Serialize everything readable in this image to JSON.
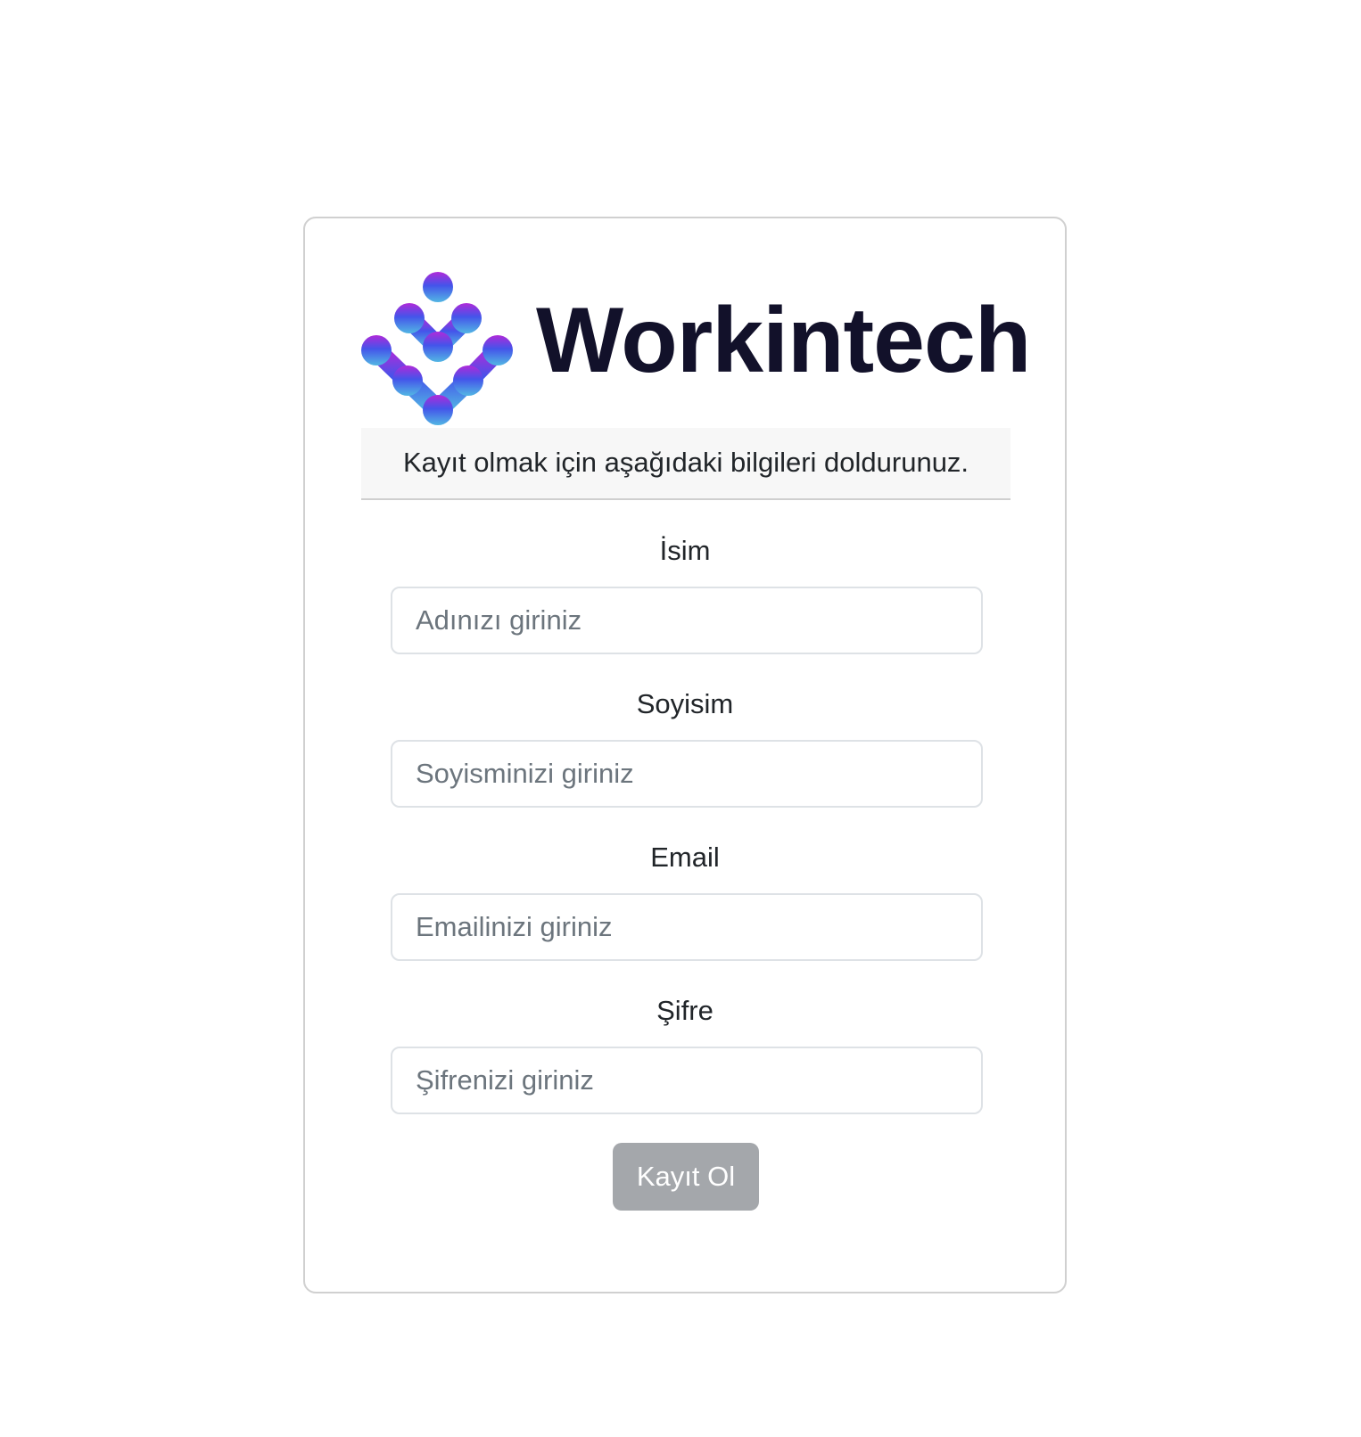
{
  "brand": {
    "name": "Workintech",
    "gradient_top": "#b02ad9",
    "gradient_mid": "#4454ea",
    "gradient_bottom": "#52b6e4"
  },
  "form": {
    "description": "Kayıt olmak için aşağıdaki bilgileri doldurunuz.",
    "fields": [
      {
        "label": "İsim",
        "placeholder": "Adınızı giriniz",
        "value": ""
      },
      {
        "label": "Soyisim",
        "placeholder": "Soyisminizi giriniz",
        "value": ""
      },
      {
        "label": "Email",
        "placeholder": "Emailinizi giriniz",
        "value": ""
      },
      {
        "label": "Şifre",
        "placeholder": "Şifrenizi giriniz",
        "value": ""
      }
    ],
    "submit_label": "Kayıt Ol"
  }
}
